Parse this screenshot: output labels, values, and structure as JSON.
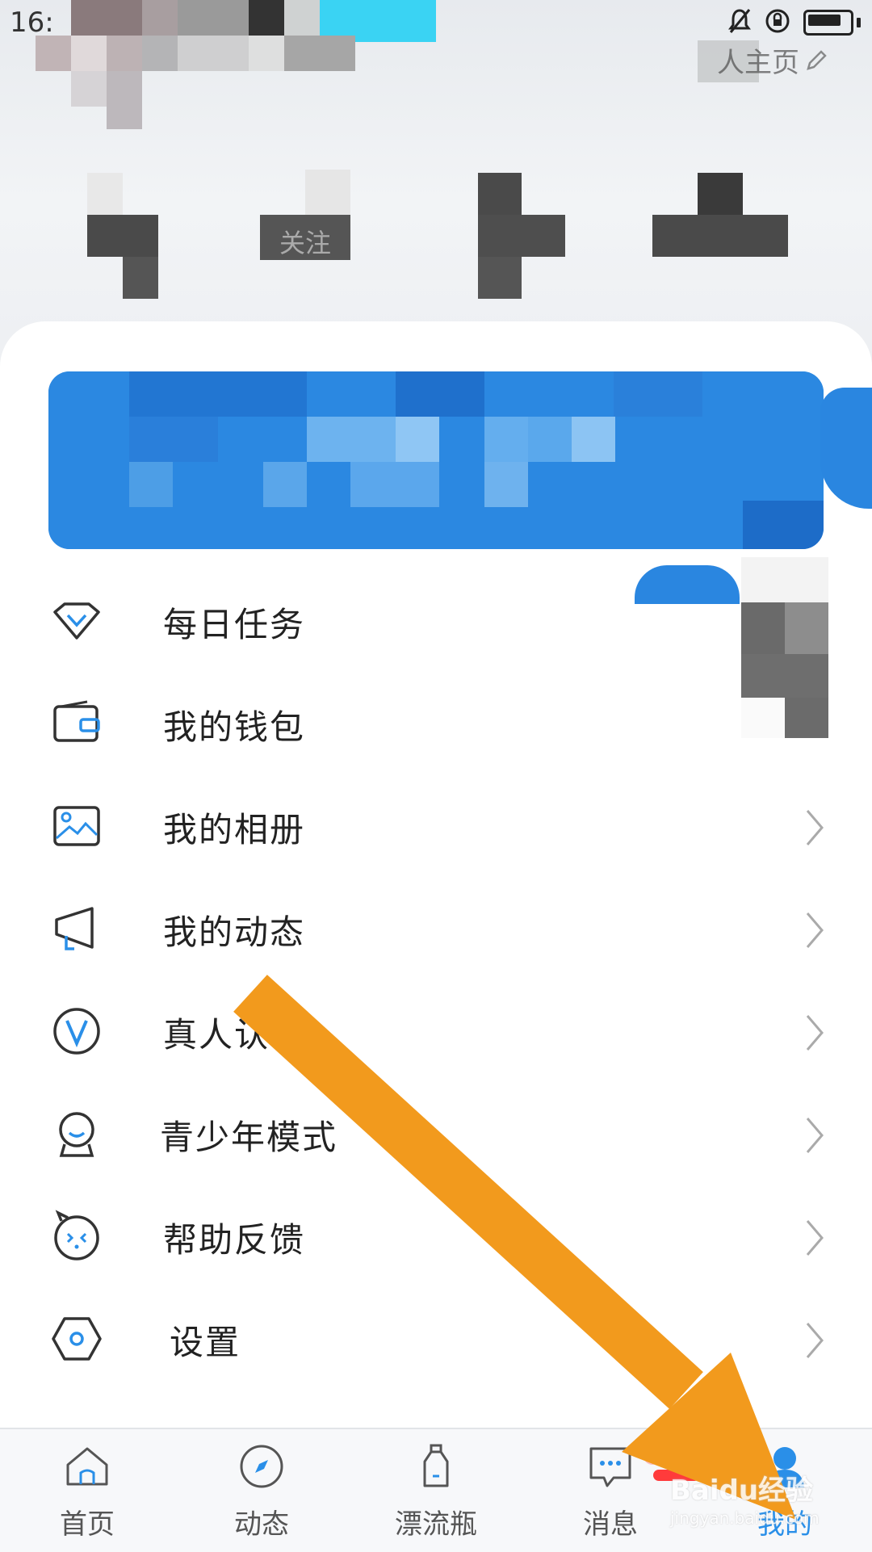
{
  "status_bar": {
    "time": "16:"
  },
  "header": {
    "profile_link": "人主页"
  },
  "stats": [
    {
      "label": ""
    },
    {
      "label": "关注"
    },
    {
      "label": ""
    },
    {
      "label": ""
    }
  ],
  "menu": [
    {
      "label": "每日任务",
      "icon": "diamond-icon",
      "chevron": false
    },
    {
      "label": "我的钱包",
      "icon": "wallet-icon",
      "chevron": false
    },
    {
      "label": "我的相册",
      "icon": "image-icon",
      "chevron": true
    },
    {
      "label": "我的动态",
      "icon": "megaphone-icon",
      "chevron": true
    },
    {
      "label": "真人认",
      "icon": "verified-v-icon",
      "chevron": true
    },
    {
      "label": "青少年模式",
      "icon": "child-face-icon",
      "chevron": true
    },
    {
      "label": "帮助反馈",
      "icon": "feedback-face-icon",
      "chevron": true
    },
    {
      "label": "设置",
      "icon": "settings-hexagon-icon",
      "chevron": true
    }
  ],
  "tabbar": {
    "tabs": [
      {
        "label": "首页",
        "icon": "home-icon"
      },
      {
        "label": "动态",
        "icon": "compass-icon"
      },
      {
        "label": "漂流瓶",
        "icon": "bottle-icon"
      },
      {
        "label": "消息",
        "icon": "message-icon"
      },
      {
        "label": "我的",
        "icon": "profile-icon",
        "active": true
      }
    ]
  },
  "colors": {
    "accent": "#2a8fe8",
    "banner": "#2a86e0",
    "arrow": "#f29a1d"
  },
  "watermark": {
    "text": "Baidu经验",
    "sub": "jingyan.baidu.com"
  }
}
